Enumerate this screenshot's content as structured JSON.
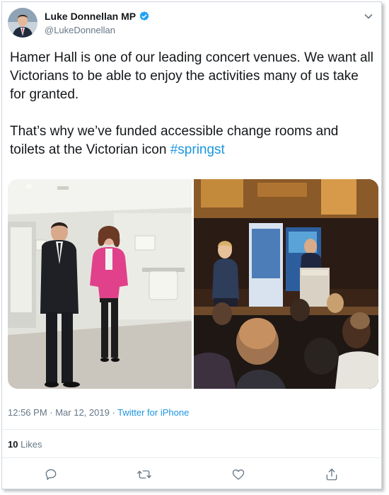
{
  "tweet": {
    "author_name": "Luke Donnellan MP",
    "handle": "@LukeDonnellan",
    "paragraph1": "Hamer Hall is one of our leading concert venues. We want all Victorians to be able to enjoy the activities many of us take for granted.",
    "paragraph2_text": "That’s why we’ve funded accessible change rooms and toilets at the Victorian icon ",
    "hashtag": "#springst",
    "time": "12:56 PM",
    "separator1": " · ",
    "date": "Mar 12, 2019",
    "separator2": " · ",
    "source": "Twitter for iPhone",
    "likes_count": "10",
    "likes_label": "Likes"
  },
  "icons": {
    "verified": "verified-badge-icon",
    "more": "chevron-down-icon",
    "reply": "reply-icon",
    "retweet": "retweet-icon",
    "like": "heart-icon",
    "share": "share-icon"
  },
  "colors": {
    "link": "#1b95e0",
    "muted": "#657786",
    "text": "#14171a",
    "border": "#e6ecf0"
  }
}
